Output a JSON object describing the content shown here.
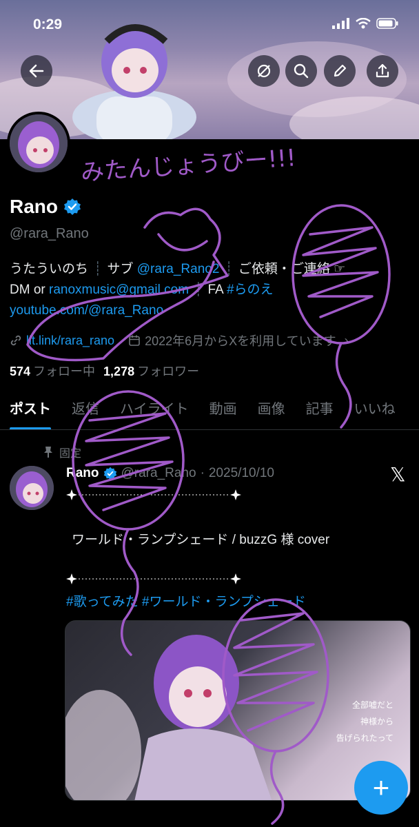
{
  "status_bar": {
    "time": "0:29"
  },
  "header_buttons": [
    "back-icon",
    "grok-icon",
    "search-icon",
    "pencil-icon",
    "share-icon"
  ],
  "profile": {
    "name": "Rano",
    "verified": true,
    "handle": "@rara_Rano",
    "bio": {
      "line1_a": "うたういのち",
      "line1_b": "サブ",
      "line1_link": "@rara_Rano2",
      "line1_c": "ご依頼・ご連絡 ☞",
      "line2_a": "DM or",
      "line2_link": "ranoxmusic@gmail.com",
      "line2_b": "FA",
      "line2_tag": "#らのえ",
      "line3_link": "youtube.com/@rara_Rano"
    },
    "meta_link": "lit.link/rara_rano",
    "joined": "2022年6月からXを利用しています",
    "following_count": "574",
    "following_label": "フォロー中",
    "followers_count": "1,278",
    "followers_label": "フォロワー"
  },
  "tabs": [
    "ポスト",
    "返信",
    "ハイライト",
    "動画",
    "画像",
    "記事",
    "いいね"
  ],
  "active_tab": 0,
  "pinned_post": {
    "pinned_label": "固定",
    "name": "Rano",
    "handle": "@rara_Rano",
    "date": "2025/10/10",
    "text": "ワールド・ランプシェード / buzzG 様 cover",
    "hashtags": "#歌ってみた #ワールド・ランプシェード",
    "media_lyrics": [
      "全部嘘だと",
      "神様から",
      "告げられたって"
    ]
  },
  "fab_label": "+",
  "doodle_text": "みたんじょうびー!!!",
  "colors": {
    "accent": "#1d9bf0",
    "doodle": "#a05ac8",
    "background": "#000000"
  }
}
